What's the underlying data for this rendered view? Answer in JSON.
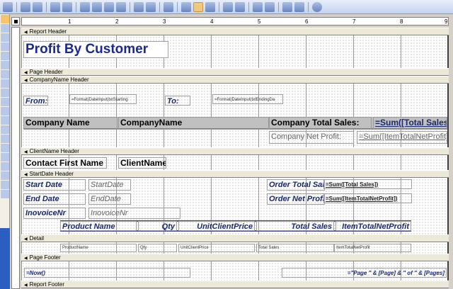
{
  "toolbar": {
    "icons": [
      "view-icon",
      "save-icon",
      "search-icon",
      "print-icon",
      "print-preview-icon",
      "cut-icon",
      "copy-icon",
      "paste-icon",
      "format-painter-icon",
      "undo-icon",
      "redo-icon",
      "hyperlink-icon",
      "field-list-icon",
      "toolbox-icon",
      "sorting-grouping-icon",
      "autoformat-icon",
      "code-icon",
      "properties-icon",
      "build-icon",
      "database-window-icon",
      "new-object-icon",
      "help-icon"
    ]
  },
  "ruler": {
    "marks": [
      "1",
      "2",
      "3",
      "4",
      "5",
      "6",
      "7",
      "8",
      "9"
    ]
  },
  "sections": {
    "report_header": "Report Header",
    "page_header": "Page Header",
    "companyname_header": "CompanyName Header",
    "clientname_header": "ClientName Header",
    "startdate_header": "StartDate Header",
    "detail": "Detail",
    "page_footer": "Page Footer",
    "report_footer": "Report Footer"
  },
  "report_header": {
    "title": "Profit By Customer"
  },
  "company_header": {
    "from_label": "From:",
    "from_value": "=Format(DateInput(txtStarting",
    "to_label": "To:",
    "to_value": "=Format(DateInput(txtEndingDa",
    "company_name_label": "Company Name",
    "company_name_value": "CompanyName",
    "total_sales_label": "Company Total Sales:",
    "total_sales_value": "=Sum([Total Sales])",
    "net_profit_label": "Company Net Profit:",
    "net_profit_value": "=Sum([ItemTotalNetProfit])"
  },
  "client_header": {
    "label": "Contact First Name",
    "value": "ClientName"
  },
  "startdate_header": {
    "start_label": "Start Date",
    "start_value": "StartDate",
    "end_label": "End Date",
    "end_value": "EndDate",
    "invoice_label": "InovoiceNr",
    "invoice_value": "InovoiceNr",
    "order_total_label": "Order Total Sales",
    "order_total_value": "=Sum([Total Sales])",
    "order_profit_label": "Order Net Profit",
    "order_profit_value": "=Sum([ItemTotalNetProfit])",
    "columns": [
      "Product Name",
      "Qty",
      "UnitClientPrice",
      "Total Sales",
      "ItemTotalNetProfit"
    ]
  },
  "detail": {
    "fields": [
      "ProductName",
      "Qty",
      "UnitClientPrice",
      "Total Sales",
      "ItemTotalNetProfit"
    ]
  },
  "page_footer": {
    "now": "=Now()",
    "page": "=\"Page \" & [Page] & \" of \" & [Pages]"
  }
}
